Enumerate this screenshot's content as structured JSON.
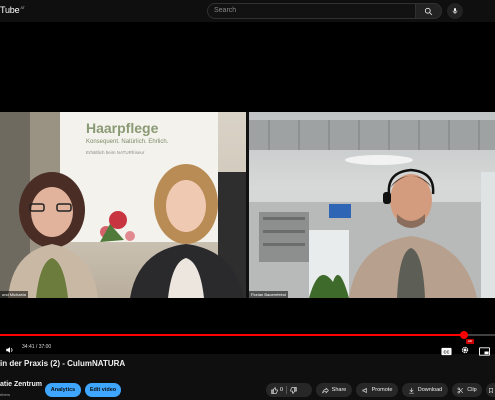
{
  "topbar": {
    "logo_text": "Tube",
    "logo_region": "AT",
    "search_placeholder": "Search"
  },
  "video": {
    "left_pane": {
      "poster_title": "Haarpflege",
      "poster_tagline": "Konsequent. Natürlich. Ehrlich.",
      "poster_subline": "Erhältlich beim NATURfriseur",
      "name_tag": "und Michaela"
    },
    "right_pane": {
      "name_tag": "Florian Bauernfeind"
    }
  },
  "player": {
    "time_current": "34:41",
    "time_separator": " / ",
    "time_total": "37:00",
    "progress_fraction": 0.9376,
    "settings_badge": "HD"
  },
  "info": {
    "title": "in der Praxis (2) - CulumNATURA",
    "channel_name": "atie Zentrum",
    "channel_sub": "ribers",
    "analytics_label": "Analytics",
    "edit_label": "Edit video",
    "like_count": "0",
    "share_label": "Share",
    "promote_label": "Promote",
    "download_label": "Download",
    "clip_label": "Clip"
  },
  "colors": {
    "accent_red": "#ff0000",
    "button_blue": "#3ea6ff",
    "pill_bg": "#272727"
  }
}
